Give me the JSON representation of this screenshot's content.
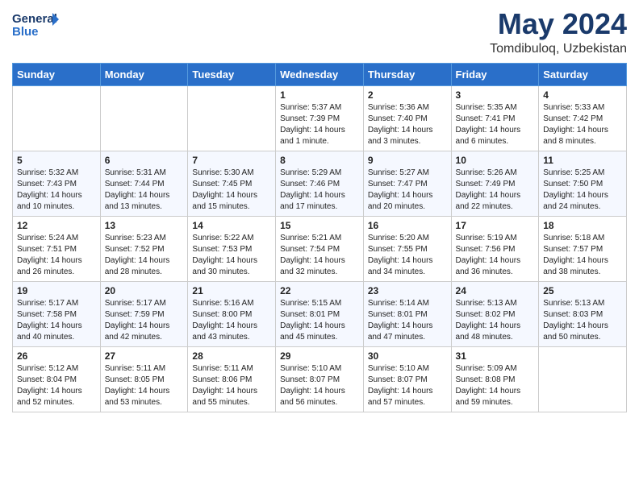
{
  "header": {
    "logo_line1": "General",
    "logo_line2": "Blue",
    "title": "May 2024",
    "subtitle": "Tomdibuloq, Uzbekistan"
  },
  "calendar": {
    "days_of_week": [
      "Sunday",
      "Monday",
      "Tuesday",
      "Wednesday",
      "Thursday",
      "Friday",
      "Saturday"
    ],
    "weeks": [
      [
        {
          "day": "",
          "info": ""
        },
        {
          "day": "",
          "info": ""
        },
        {
          "day": "",
          "info": ""
        },
        {
          "day": "1",
          "info": "Sunrise: 5:37 AM\nSunset: 7:39 PM\nDaylight: 14 hours\nand 1 minute."
        },
        {
          "day": "2",
          "info": "Sunrise: 5:36 AM\nSunset: 7:40 PM\nDaylight: 14 hours\nand 3 minutes."
        },
        {
          "day": "3",
          "info": "Sunrise: 5:35 AM\nSunset: 7:41 PM\nDaylight: 14 hours\nand 6 minutes."
        },
        {
          "day": "4",
          "info": "Sunrise: 5:33 AM\nSunset: 7:42 PM\nDaylight: 14 hours\nand 8 minutes."
        }
      ],
      [
        {
          "day": "5",
          "info": "Sunrise: 5:32 AM\nSunset: 7:43 PM\nDaylight: 14 hours\nand 10 minutes."
        },
        {
          "day": "6",
          "info": "Sunrise: 5:31 AM\nSunset: 7:44 PM\nDaylight: 14 hours\nand 13 minutes."
        },
        {
          "day": "7",
          "info": "Sunrise: 5:30 AM\nSunset: 7:45 PM\nDaylight: 14 hours\nand 15 minutes."
        },
        {
          "day": "8",
          "info": "Sunrise: 5:29 AM\nSunset: 7:46 PM\nDaylight: 14 hours\nand 17 minutes."
        },
        {
          "day": "9",
          "info": "Sunrise: 5:27 AM\nSunset: 7:47 PM\nDaylight: 14 hours\nand 20 minutes."
        },
        {
          "day": "10",
          "info": "Sunrise: 5:26 AM\nSunset: 7:49 PM\nDaylight: 14 hours\nand 22 minutes."
        },
        {
          "day": "11",
          "info": "Sunrise: 5:25 AM\nSunset: 7:50 PM\nDaylight: 14 hours\nand 24 minutes."
        }
      ],
      [
        {
          "day": "12",
          "info": "Sunrise: 5:24 AM\nSunset: 7:51 PM\nDaylight: 14 hours\nand 26 minutes."
        },
        {
          "day": "13",
          "info": "Sunrise: 5:23 AM\nSunset: 7:52 PM\nDaylight: 14 hours\nand 28 minutes."
        },
        {
          "day": "14",
          "info": "Sunrise: 5:22 AM\nSunset: 7:53 PM\nDaylight: 14 hours\nand 30 minutes."
        },
        {
          "day": "15",
          "info": "Sunrise: 5:21 AM\nSunset: 7:54 PM\nDaylight: 14 hours\nand 32 minutes."
        },
        {
          "day": "16",
          "info": "Sunrise: 5:20 AM\nSunset: 7:55 PM\nDaylight: 14 hours\nand 34 minutes."
        },
        {
          "day": "17",
          "info": "Sunrise: 5:19 AM\nSunset: 7:56 PM\nDaylight: 14 hours\nand 36 minutes."
        },
        {
          "day": "18",
          "info": "Sunrise: 5:18 AM\nSunset: 7:57 PM\nDaylight: 14 hours\nand 38 minutes."
        }
      ],
      [
        {
          "day": "19",
          "info": "Sunrise: 5:17 AM\nSunset: 7:58 PM\nDaylight: 14 hours\nand 40 minutes."
        },
        {
          "day": "20",
          "info": "Sunrise: 5:17 AM\nSunset: 7:59 PM\nDaylight: 14 hours\nand 42 minutes."
        },
        {
          "day": "21",
          "info": "Sunrise: 5:16 AM\nSunset: 8:00 PM\nDaylight: 14 hours\nand 43 minutes."
        },
        {
          "day": "22",
          "info": "Sunrise: 5:15 AM\nSunset: 8:01 PM\nDaylight: 14 hours\nand 45 minutes."
        },
        {
          "day": "23",
          "info": "Sunrise: 5:14 AM\nSunset: 8:01 PM\nDaylight: 14 hours\nand 47 minutes."
        },
        {
          "day": "24",
          "info": "Sunrise: 5:13 AM\nSunset: 8:02 PM\nDaylight: 14 hours\nand 48 minutes."
        },
        {
          "day": "25",
          "info": "Sunrise: 5:13 AM\nSunset: 8:03 PM\nDaylight: 14 hours\nand 50 minutes."
        }
      ],
      [
        {
          "day": "26",
          "info": "Sunrise: 5:12 AM\nSunset: 8:04 PM\nDaylight: 14 hours\nand 52 minutes."
        },
        {
          "day": "27",
          "info": "Sunrise: 5:11 AM\nSunset: 8:05 PM\nDaylight: 14 hours\nand 53 minutes."
        },
        {
          "day": "28",
          "info": "Sunrise: 5:11 AM\nSunset: 8:06 PM\nDaylight: 14 hours\nand 55 minutes."
        },
        {
          "day": "29",
          "info": "Sunrise: 5:10 AM\nSunset: 8:07 PM\nDaylight: 14 hours\nand 56 minutes."
        },
        {
          "day": "30",
          "info": "Sunrise: 5:10 AM\nSunset: 8:07 PM\nDaylight: 14 hours\nand 57 minutes."
        },
        {
          "day": "31",
          "info": "Sunrise: 5:09 AM\nSunset: 8:08 PM\nDaylight: 14 hours\nand 59 minutes."
        },
        {
          "day": "",
          "info": ""
        }
      ]
    ]
  }
}
